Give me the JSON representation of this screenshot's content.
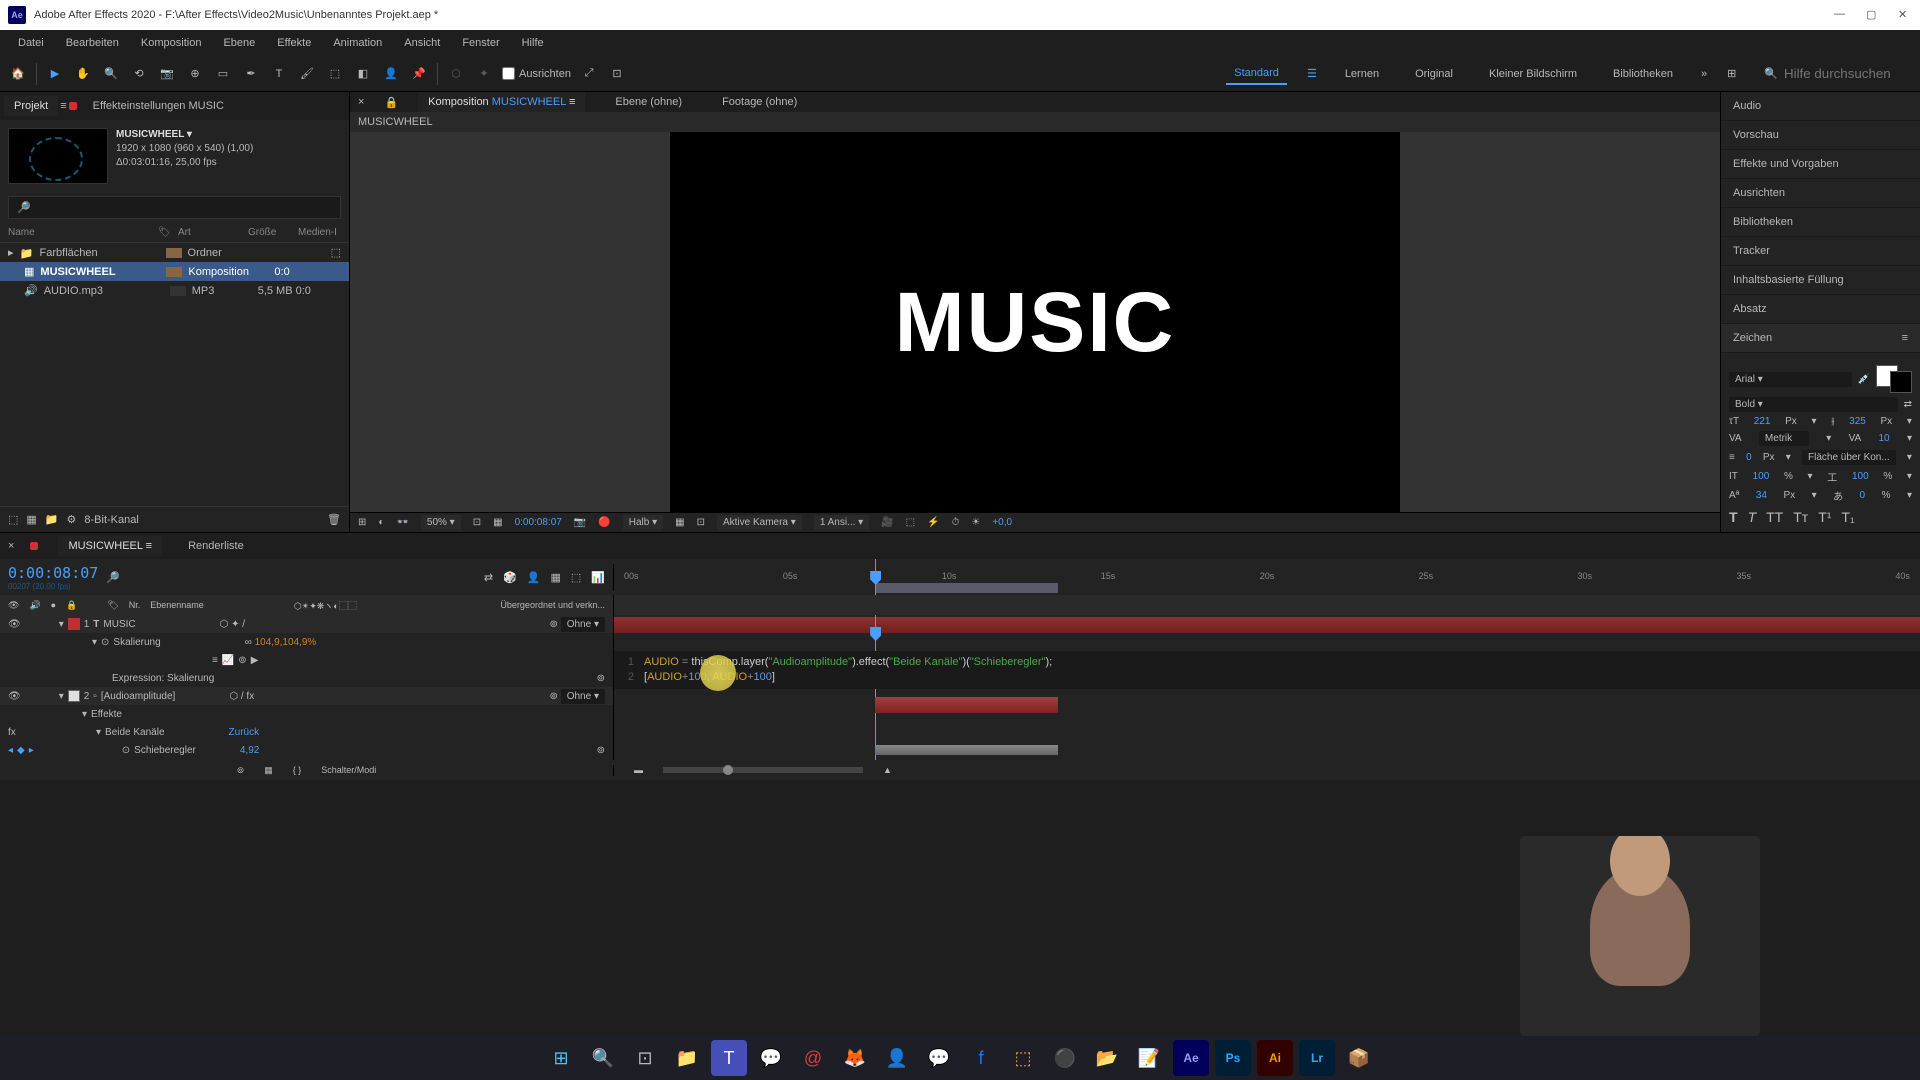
{
  "titlebar": {
    "app": "Adobe After Effects 2020",
    "path": "F:\\After Effects\\Video2Music\\Unbenanntes Projekt.aep *"
  },
  "menu": [
    "Datei",
    "Bearbeiten",
    "Komposition",
    "Ebene",
    "Effekte",
    "Animation",
    "Ansicht",
    "Fenster",
    "Hilfe"
  ],
  "toolbar": {
    "align": "Ausrichten",
    "workspaces": [
      "Standard",
      "Lernen",
      "Original",
      "Kleiner Bildschirm",
      "Bibliotheken"
    ],
    "active_workspace": "Standard",
    "search_placeholder": "Hilfe durchsuchen"
  },
  "project": {
    "tab1": "Projekt",
    "tab2": "Effekteinstellungen MUSIC",
    "comp_name": "MUSICWHEEL",
    "comp_dims": "1920 x 1080 (960 x 540) (1,00)",
    "comp_dur": "Δ0:03:01:16, 25,00 fps",
    "headers": {
      "name": "Name",
      "art": "Art",
      "size": "Größe",
      "media": "Medien-I"
    },
    "items": [
      {
        "name": "Farbflächen",
        "art": "Ordner",
        "size": "",
        "type": "folder"
      },
      {
        "name": "MUSICWHEEL",
        "art": "Komposition",
        "size": "0:0",
        "type": "comp",
        "selected": true
      },
      {
        "name": "AUDIO.mp3",
        "art": "MP3",
        "size": "5,5 MB   0:0",
        "type": "audio"
      }
    ],
    "footer_depth": "8-Bit-Kanal"
  },
  "comp_panel": {
    "tab_comp": "Komposition",
    "tab_comp_name": "MUSICWHEEL",
    "tab_layer": "Ebene (ohne)",
    "tab_footage": "Footage (ohne)",
    "breadcrumb": "MUSICWHEEL",
    "canvas_text": "MUSIC",
    "zoom": "50%",
    "time": "0:00:08:07",
    "res": "Halb",
    "camera": "Aktive Kamera",
    "views": "1 Ansi...",
    "exp": "+0,0"
  },
  "right_panels": [
    "Audio",
    "Vorschau",
    "Effekte und Vorgaben",
    "Ausrichten",
    "Bibliotheken",
    "Tracker",
    "Inhaltsbasierte Füllung",
    "Absatz"
  ],
  "char": {
    "title": "Zeichen",
    "font": "Arial",
    "weight": "Bold",
    "size": "221",
    "size_unit": "Px",
    "leading": "325",
    "leading_unit": "Px",
    "kerning": "Metrik",
    "tracking": "10",
    "stroke": "0",
    "stroke_unit": "Px",
    "stroke_mode": "Fläche über Kon...",
    "vscale": "100",
    "hscale": "100",
    "scale_unit": "%",
    "baseline": "34",
    "baseline_unit": "Px",
    "tsume": "0",
    "tsume_unit": "%"
  },
  "timeline": {
    "tab_name": "MUSICWHEEL",
    "tab_render": "Renderliste",
    "timecode": "0:00:08:07",
    "timecode_sub": "00207 (20,00 fps)",
    "ruler": [
      "00s",
      "05s",
      "10s",
      "15s",
      "20s",
      "25s",
      "30s",
      "35s",
      "40s"
    ],
    "col_nr": "Nr.",
    "col_name": "Ebenenname",
    "col_parent": "Übergeordnet und verkn...",
    "parent_none": "Ohne",
    "layers": [
      {
        "num": "1",
        "name": "MUSIC",
        "color": "red",
        "type": "T"
      },
      {
        "num": "2",
        "name": "[Audioamplitude]",
        "color": "white"
      }
    ],
    "prop_scale": "Skalierung",
    "prop_scale_val": "104,9,104,9%",
    "expr_label": "Expression: Skalierung",
    "fx_label": "Effekte",
    "channels": "Beide Kanäle",
    "channels_val": "Zurück",
    "slider": "Schieberegler",
    "slider_val": "4,92",
    "expression": {
      "line1_var": "AUDIO",
      "line1_code": "thisComp.layer(",
      "line1_str1": "\"Audioamplitude\"",
      "line1_mid": ").effect(",
      "line1_str2": "\"Beide Kanäle\"",
      "line1_mid2": ")(",
      "line1_str3": "\"Schieberegler\"",
      "line1_end": ");",
      "line2_open": "[",
      "line2_a": "AUDIO",
      "line2_plus": "+",
      "line2_n1": "100",
      "line2_comma": ", ",
      "line2_n2": "100",
      "line2_close": "]"
    },
    "footer": "Schalter/Modi"
  }
}
